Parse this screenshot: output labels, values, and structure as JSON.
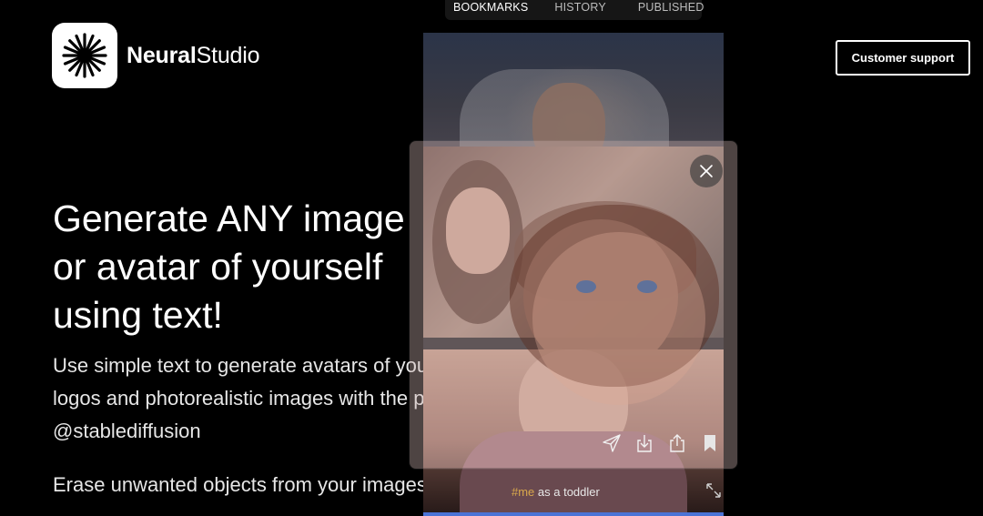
{
  "brand": {
    "name_bold": "Neural",
    "name_light": "Studio",
    "logo_icon": "sparkle-burst-icon"
  },
  "header": {
    "support_label": "Customer support"
  },
  "tabs": [
    {
      "label": "BOOKMARKS",
      "active": true
    },
    {
      "label": "HISTORY",
      "active": false
    },
    {
      "label": "PUBLISHED",
      "active": false
    }
  ],
  "hero": {
    "headline_line1": "Generate ANY image",
    "headline_line2": "or avatar of yourself",
    "headline_line3": "using text!",
    "subtext": "Use simple text to generate avatars of yourself, art, logos and photorealistic images with the power of @stablediffusion",
    "erase_text": "Erase unwanted objects from your images"
  },
  "feed": {
    "caption_tag": "#me",
    "caption_rest": " as a toddler",
    "icons": [
      "send-icon",
      "download-icon",
      "share-icon",
      "bookmark-icon",
      "expand-icon",
      "close-icon"
    ]
  },
  "colors": {
    "background": "#000000",
    "accent_tag": "#d9a84c",
    "bar_blue": "#4a73d6"
  }
}
